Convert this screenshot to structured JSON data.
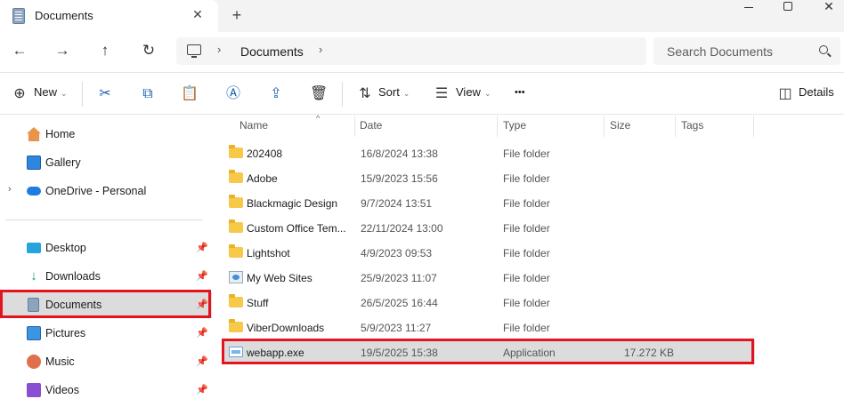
{
  "window": {
    "tab_title": "Documents",
    "close_tab_glyph": "✕",
    "new_tab_glyph": "+",
    "close_glyph": "✕"
  },
  "nav": {
    "back_glyph": "←",
    "forward_glyph": "→",
    "up_glyph": "↑",
    "refresh_glyph": "↻",
    "breadcrumb_sep": "›",
    "breadcrumb_current": "Documents",
    "search_placeholder": "Search Documents"
  },
  "toolbar": {
    "new_label": "New",
    "sort_label": "Sort",
    "view_label": "View",
    "more_glyph": "•••",
    "details_label": "Details",
    "caret_glyph": "⌄",
    "accent_color": "#1a5fb4"
  },
  "sidebar": {
    "top_items": [
      {
        "label": "Home",
        "icon": "home-icon"
      },
      {
        "label": "Gallery",
        "icon": "gallery-icon"
      },
      {
        "label": "OneDrive - Personal",
        "icon": "cloud-icon"
      }
    ],
    "pinned_items": [
      {
        "label": "Desktop",
        "icon": "desktop-icon"
      },
      {
        "label": "Downloads",
        "icon": "download-icon"
      },
      {
        "label": "Documents",
        "icon": "document-icon",
        "selected": true
      },
      {
        "label": "Pictures",
        "icon": "pictures-icon"
      },
      {
        "label": "Music",
        "icon": "music-icon"
      },
      {
        "label": "Videos",
        "icon": "videos-icon"
      }
    ],
    "chevron_glyph": "›",
    "pin_glyph": "📌"
  },
  "columns": {
    "name": "Name",
    "date": "Date",
    "type": "Type",
    "size": "Size",
    "tags": "Tags",
    "sort_caret": "^"
  },
  "files": [
    {
      "name": "202408",
      "date": "16/8/2024 13:38",
      "type": "File folder",
      "size": "",
      "icon": "folder-icon"
    },
    {
      "name": "Adobe",
      "date": "15/9/2023 15:56",
      "type": "File folder",
      "size": "",
      "icon": "folder-icon"
    },
    {
      "name": "Blackmagic Design",
      "date": "9/7/2024 13:51",
      "type": "File folder",
      "size": "",
      "icon": "folder-icon"
    },
    {
      "name": "Custom Office Tem...",
      "date": "22/11/2024 13:00",
      "type": "File folder",
      "size": "",
      "icon": "folder-icon"
    },
    {
      "name": "Lightshot",
      "date": "4/9/2023 09:53",
      "type": "File folder",
      "size": "",
      "icon": "folder-icon"
    },
    {
      "name": "My Web Sites",
      "date": "25/9/2023 11:07",
      "type": "File folder",
      "size": "",
      "icon": "websites-folder-icon"
    },
    {
      "name": "Stuff",
      "date": "26/5/2025 16:44",
      "type": "File folder",
      "size": "",
      "icon": "folder-icon"
    },
    {
      "name": "ViberDownloads",
      "date": "5/9/2023 11:27",
      "type": "File folder",
      "size": "",
      "icon": "folder-icon"
    },
    {
      "name": "webapp.exe",
      "date": "19/5/2025 15:38",
      "type": "Application",
      "size": "17.272 KB",
      "icon": "application-icon",
      "selected": true
    }
  ],
  "highlight_color": "#e3141f"
}
